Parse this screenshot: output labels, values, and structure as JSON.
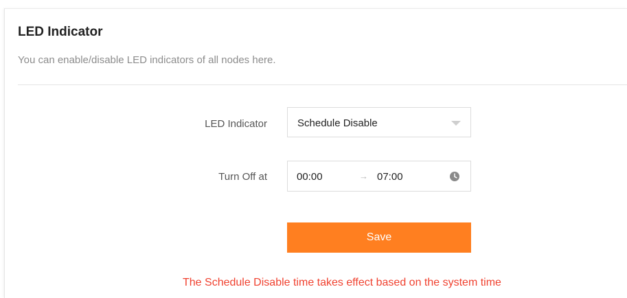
{
  "header": {
    "title": "LED Indicator",
    "subtitle": "You can enable/disable LED indicators of all nodes here."
  },
  "form": {
    "led_label": "LED Indicator",
    "led_select_value": "Schedule Disable",
    "turn_off_label": "Turn Off at",
    "time_start": "00:00",
    "time_separator": "→",
    "time_end": "07:00",
    "save_label": "Save"
  },
  "notice": "The Schedule Disable time takes effect based on the system time",
  "icons": {
    "dropdown": "chevron-down-icon",
    "clock": "clock-icon"
  },
  "colors": {
    "accent": "#ff7f20",
    "notice": "#f0412f",
    "title": "#222222",
    "subtitle": "#8c8c8c"
  }
}
